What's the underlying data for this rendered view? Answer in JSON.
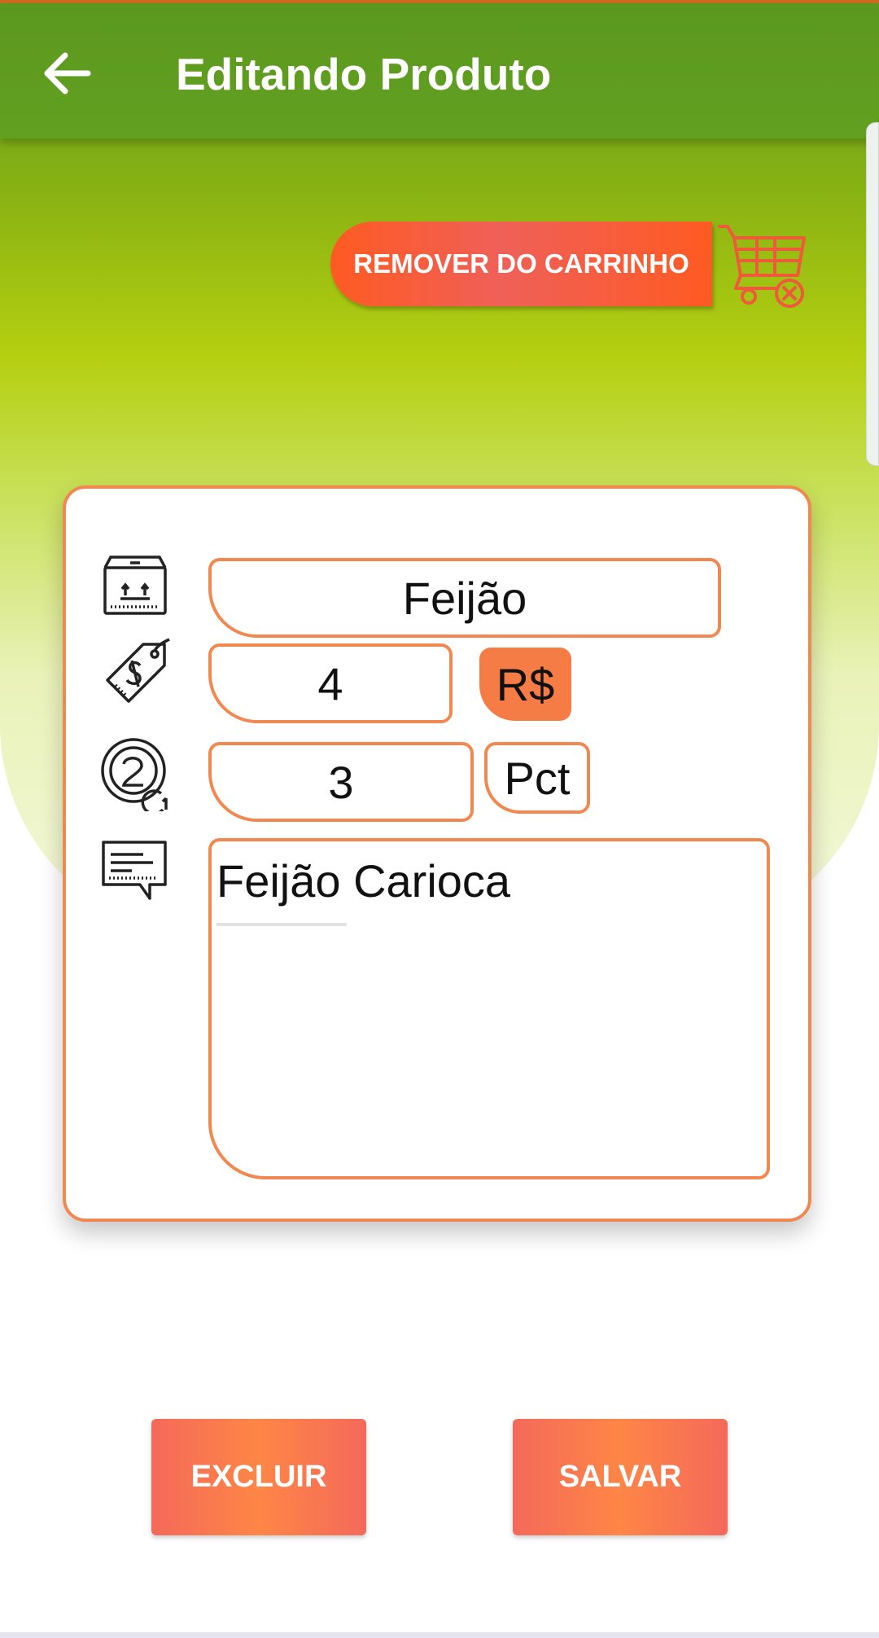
{
  "appbar": {
    "title": "Editando Produto",
    "back_icon": "arrow-left-icon"
  },
  "cart_action": {
    "label": "REMOVER DO CARRINHO",
    "icon": "cart-remove-icon"
  },
  "form": {
    "name": {
      "icon": "box-icon",
      "value": "Feijão"
    },
    "price": {
      "icon": "price-tag-icon",
      "value": "4",
      "currency": "R$"
    },
    "quantity": {
      "icon": "coin-counter-icon",
      "value": "3",
      "unit": "Pct"
    },
    "description": {
      "icon": "message-icon",
      "value": "Feijão Carioca"
    }
  },
  "actions": {
    "delete_label": "EXCLUIR",
    "save_label": "SALVAR"
  },
  "colors": {
    "appbar": "#5e9a1f",
    "accent_orange": "#f0884f",
    "button_orange": "#ff5a22",
    "currency_badge": "#f67c46"
  }
}
